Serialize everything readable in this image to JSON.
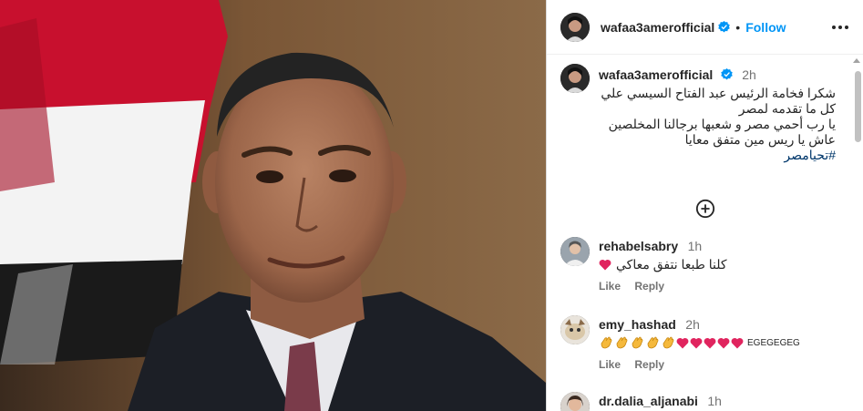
{
  "post": {
    "username": "wafaa3amerofficial",
    "follow_label": "Follow",
    "separator": "•"
  },
  "caption": {
    "username": "wafaa3amerofficial",
    "time": "2h",
    "lines": [
      "شكرا فخامة الرئيس عبد الفتاح السيسي علي",
      "كل ما تقدمه لمصر",
      "يا رب أحمي مصر و شعبها برجالنا المخلصين",
      "عاش يا ريس مين متفق معايا"
    ],
    "hashtag": "#تحيامصر"
  },
  "comments": [
    {
      "username": "rehabelsabry",
      "time": "1h",
      "text": "كلنا طبعا نتفق معاكي",
      "like_label": "Like",
      "reply_label": "Reply"
    },
    {
      "username": "emy_hashad",
      "time": "2h",
      "text_suffix": "EGEGEGEG",
      "like_label": "Like",
      "reply_label": "Reply"
    },
    {
      "username": "dr.dalia_aljanabi",
      "time": "1h"
    }
  ],
  "colors": {
    "accent": "#0095f6",
    "verified": "#0095f6",
    "heart": "#e0245e",
    "hashtag": "#00376b",
    "muted": "#737373"
  },
  "icons": [
    "verified-badge-icon",
    "more-options-icon",
    "add-comment-icon",
    "heart-icon",
    "clap-icon"
  ]
}
